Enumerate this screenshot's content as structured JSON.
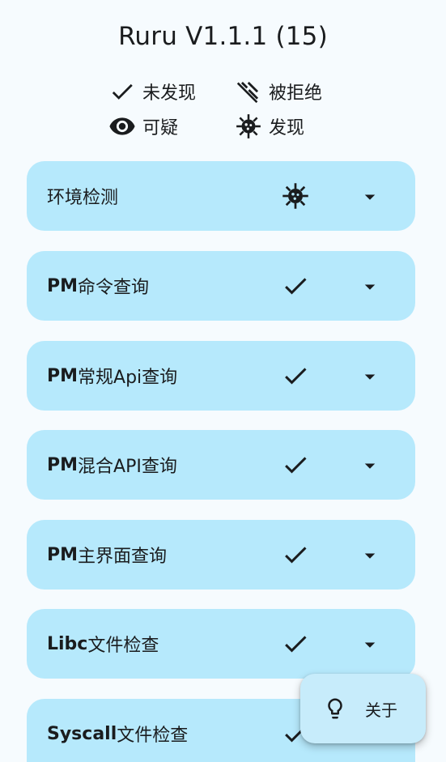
{
  "app": {
    "title": "Ruru V1.1.1 (15)"
  },
  "legend": [
    {
      "icon": "check-icon",
      "label": "未发现"
    },
    {
      "icon": "eye-off-icon",
      "label": "被拒绝"
    },
    {
      "icon": "eye-icon",
      "label": "可疑"
    },
    {
      "icon": "virus-icon",
      "label": "发现"
    }
  ],
  "cards": [
    {
      "prefix": "",
      "label": "环境检测",
      "status": "virus-icon",
      "expand_icon": "arrow-drop-down-icon"
    },
    {
      "prefix": "PM",
      "label": " 命令查询",
      "status": "check-icon",
      "expand_icon": "arrow-drop-down-icon"
    },
    {
      "prefix": "PM",
      "label": " 常规Api查询",
      "status": "check-icon",
      "expand_icon": "arrow-drop-down-icon"
    },
    {
      "prefix": "PM",
      "label": " 混合API查询",
      "status": "check-icon",
      "expand_icon": "arrow-drop-down-icon"
    },
    {
      "prefix": "PM",
      "label": " 主界面查询",
      "status": "check-icon",
      "expand_icon": "arrow-drop-down-icon"
    },
    {
      "prefix": "Libc",
      "label": " 文件检查",
      "status": "check-icon",
      "expand_icon": "arrow-drop-down-icon"
    },
    {
      "prefix": "Syscall",
      "label": " 文件检查",
      "status": "check-icon",
      "expand_icon": "arrow-drop-down-icon"
    }
  ],
  "fab": {
    "icon": "lightbulb-icon",
    "label": "关于"
  },
  "colors": {
    "background": "#f6fbfe",
    "card": "#b6e9fc",
    "fab": "#c7ecfb",
    "text": "#1a1c1e"
  }
}
